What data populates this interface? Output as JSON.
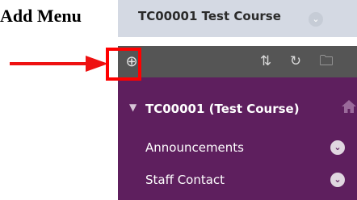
{
  "doc": {
    "heading": "Add Menu"
  },
  "header": {
    "course_title": "TC00001 Test Course",
    "chevron_glyph": "⌄"
  },
  "toolbar": {
    "add_glyph": "⊕",
    "sort_glyph": "⇅",
    "refresh_glyph": "↻",
    "folder_glyph": "🗀"
  },
  "nav": {
    "course_label": "TC00001 (Test Course)",
    "items": [
      {
        "label": "Announcements",
        "opt_glyph": "⌄"
      },
      {
        "label": "Staff Contact",
        "opt_glyph": "⌄"
      }
    ]
  },
  "colors": {
    "header_bg": "#d4d9e3",
    "toolbar_bg": "#555555",
    "sidebar_bg": "#5e1f5e",
    "callout": "#ff0000"
  }
}
